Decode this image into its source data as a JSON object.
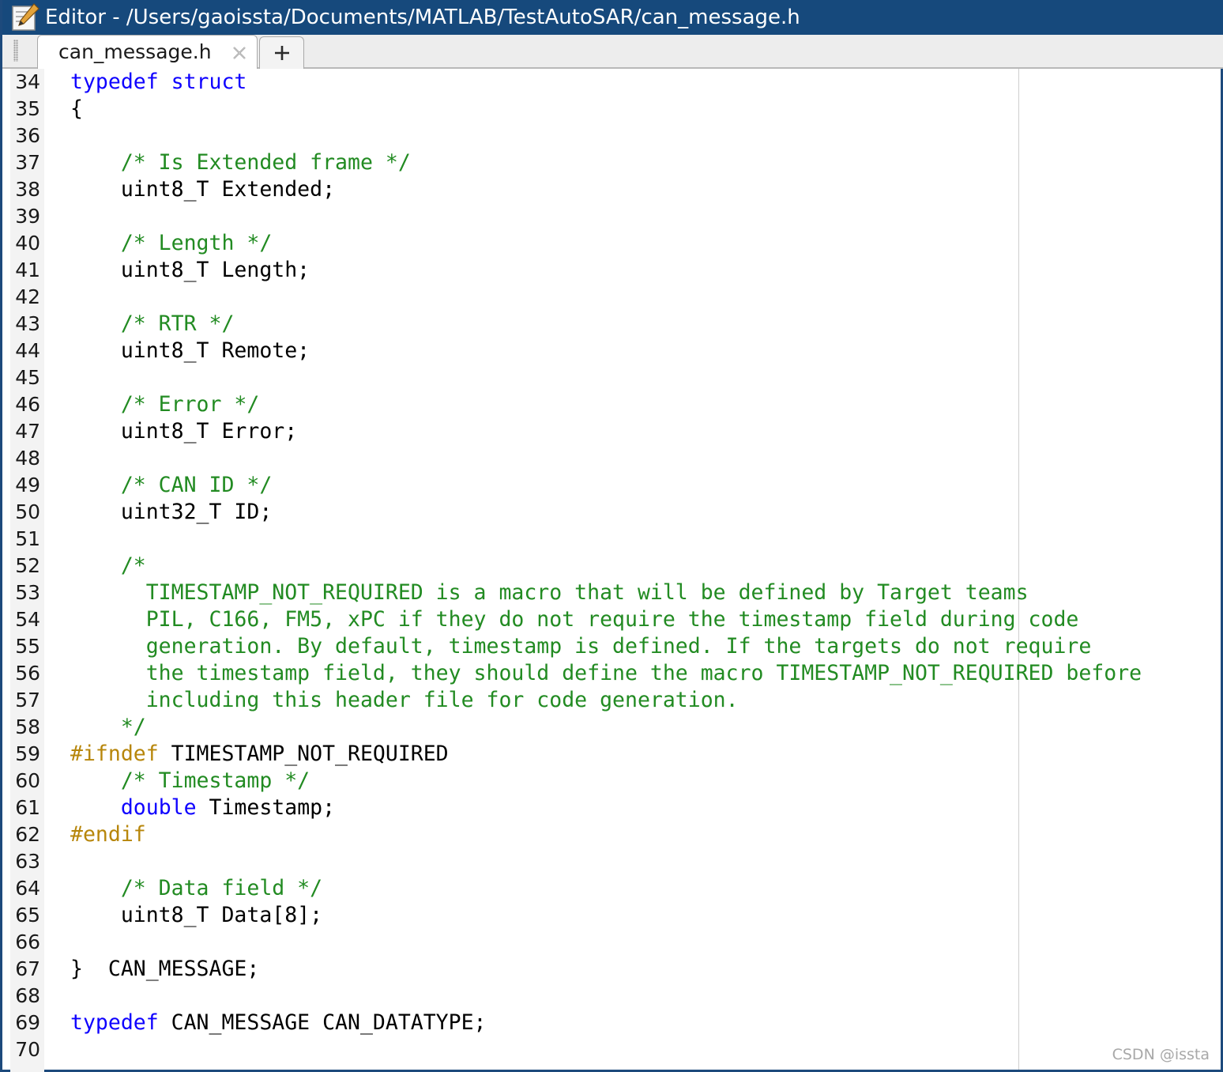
{
  "window": {
    "title": "Editor - /Users/gaoissta/Documents/MATLAB/TestAutoSAR/can_message.h",
    "icon": "edit-pencil-icon"
  },
  "tabs": [
    {
      "label": "can_message.h",
      "close_icon": "close-icon",
      "active": true
    }
  ],
  "new_tab_icon": "plus-icon",
  "colors": {
    "titlebar": "#16497c",
    "keyword": "#0e00ff",
    "comment": "#228b22",
    "preprocessor": "#b7860b",
    "text": "#000000"
  },
  "editor": {
    "lines": [
      {
        "num": "34",
        "tokens": [
          {
            "t": "typedef struct",
            "c": "kw"
          }
        ]
      },
      {
        "num": "35",
        "tokens": [
          {
            "t": "{",
            "c": "tx"
          }
        ]
      },
      {
        "num": "36",
        "tokens": []
      },
      {
        "num": "37",
        "tokens": [
          {
            "t": "    /* Is Extended frame */",
            "c": "cm"
          }
        ]
      },
      {
        "num": "38",
        "tokens": [
          {
            "t": "    uint8_T Extended;",
            "c": "tx"
          }
        ]
      },
      {
        "num": "39",
        "tokens": []
      },
      {
        "num": "40",
        "tokens": [
          {
            "t": "    /* Length */",
            "c": "cm"
          }
        ]
      },
      {
        "num": "41",
        "tokens": [
          {
            "t": "    uint8_T Length;",
            "c": "tx"
          }
        ]
      },
      {
        "num": "42",
        "tokens": []
      },
      {
        "num": "43",
        "tokens": [
          {
            "t": "    /* RTR */",
            "c": "cm"
          }
        ]
      },
      {
        "num": "44",
        "tokens": [
          {
            "t": "    uint8_T Remote;",
            "c": "tx"
          }
        ]
      },
      {
        "num": "45",
        "tokens": []
      },
      {
        "num": "46",
        "tokens": [
          {
            "t": "    /* Error */",
            "c": "cm"
          }
        ]
      },
      {
        "num": "47",
        "tokens": [
          {
            "t": "    uint8_T Error;",
            "c": "tx"
          }
        ]
      },
      {
        "num": "48",
        "tokens": []
      },
      {
        "num": "49",
        "tokens": [
          {
            "t": "    /* CAN ID */",
            "c": "cm"
          }
        ]
      },
      {
        "num": "50",
        "tokens": [
          {
            "t": "    uint32_T ID;",
            "c": "tx"
          }
        ]
      },
      {
        "num": "51",
        "tokens": []
      },
      {
        "num": "52",
        "tokens": [
          {
            "t": "    /*",
            "c": "cm"
          }
        ]
      },
      {
        "num": "53",
        "tokens": [
          {
            "t": "      TIMESTAMP_NOT_REQUIRED is a macro that will be defined by Target teams",
            "c": "cm"
          }
        ]
      },
      {
        "num": "54",
        "tokens": [
          {
            "t": "      PIL, C166, FM5, xPC if they do not require the timestamp field during code",
            "c": "cm"
          }
        ]
      },
      {
        "num": "55",
        "tokens": [
          {
            "t": "      generation. By default, timestamp is defined. If the targets do not require",
            "c": "cm"
          }
        ]
      },
      {
        "num": "56",
        "tokens": [
          {
            "t": "      the timestamp field, they should define the macro TIMESTAMP_NOT_REQUIRED before",
            "c": "cm"
          }
        ]
      },
      {
        "num": "57",
        "tokens": [
          {
            "t": "      including this header file for code generation.",
            "c": "cm"
          }
        ]
      },
      {
        "num": "58",
        "tokens": [
          {
            "t": "    */",
            "c": "cm"
          }
        ]
      },
      {
        "num": "59",
        "tokens": [
          {
            "t": "#ifndef",
            "c": "pp"
          },
          {
            "t": " TIMESTAMP_NOT_REQUIRED",
            "c": "tx"
          }
        ]
      },
      {
        "num": "60",
        "tokens": [
          {
            "t": "    /* Timestamp */",
            "c": "cm"
          }
        ]
      },
      {
        "num": "61",
        "tokens": [
          {
            "t": "    ",
            "c": "tx"
          },
          {
            "t": "double",
            "c": "kw"
          },
          {
            "t": " Timestamp;",
            "c": "tx"
          }
        ]
      },
      {
        "num": "62",
        "tokens": [
          {
            "t": "#endif",
            "c": "pp"
          }
        ]
      },
      {
        "num": "63",
        "tokens": []
      },
      {
        "num": "64",
        "tokens": [
          {
            "t": "    /* Data field */",
            "c": "cm"
          }
        ]
      },
      {
        "num": "65",
        "tokens": [
          {
            "t": "    uint8_T Data[8];",
            "c": "tx"
          }
        ]
      },
      {
        "num": "66",
        "tokens": []
      },
      {
        "num": "67",
        "tokens": [
          {
            "t": "}  CAN_MESSAGE;",
            "c": "tx"
          }
        ]
      },
      {
        "num": "68",
        "tokens": []
      },
      {
        "num": "69",
        "tokens": [
          {
            "t": "typedef",
            "c": "kw"
          },
          {
            "t": " CAN_MESSAGE CAN_DATATYPE;",
            "c": "tx"
          }
        ]
      },
      {
        "num": "70",
        "tokens": []
      }
    ]
  },
  "watermark": "CSDN @issta"
}
